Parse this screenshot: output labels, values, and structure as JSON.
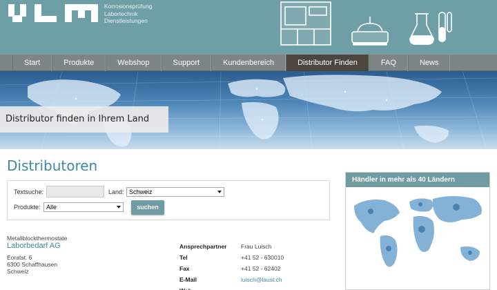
{
  "header": {
    "tagline": [
      "Korrosionsprüfung",
      "Labortechnik",
      "Dienstleistungen"
    ],
    "logo_icon": "vlm-logo",
    "device_icons": [
      "test-chamber-icon",
      "lab-instrument-icon",
      "flask-icon",
      "test-tube-icon"
    ],
    "colors": {
      "header_bg": "#6f9fa6",
      "nav_bg": "#7e8585",
      "nav_active": "#4c4540",
      "accent": "#3a8aa3"
    }
  },
  "nav": {
    "items": [
      {
        "label": "Start"
      },
      {
        "label": "Produkte"
      },
      {
        "label": "Webshop"
      },
      {
        "label": "Support"
      },
      {
        "label": "Kundenbereich"
      },
      {
        "label": "Distributor Finden",
        "active": true
      },
      {
        "label": "FAQ"
      },
      {
        "label": "News"
      }
    ]
  },
  "banner": {
    "caption": "Distributor finden in Ihrem Land"
  },
  "main": {
    "title": "Distributoren",
    "search": {
      "text_label": "Textsuche:",
      "text_value": "",
      "country_label": "Land:",
      "country_value": "Schweiz",
      "products_label": "Produkte:",
      "products_value": "Alle",
      "submit_label": "suchen"
    },
    "result": {
      "category": "Metallblockthermostate",
      "company": "Laborbedarf AG",
      "address": [
        "Eoratst. 6",
        "6300 Schaffhausen",
        "Schweiz"
      ],
      "contact": [
        {
          "key": "Ansprechpartner",
          "value": "Frau Luisch"
        },
        {
          "key": "Tel",
          "value": "+41 52 - 630010"
        },
        {
          "key": "Fax",
          "value": "+41 52 - 62402"
        },
        {
          "key": "E-Mail",
          "value": "luisch@laust.ch"
        },
        {
          "key": "Web",
          "value": ""
        }
      ]
    }
  },
  "sidebar": {
    "title": "Händler in mehr als 40 Ländern"
  }
}
